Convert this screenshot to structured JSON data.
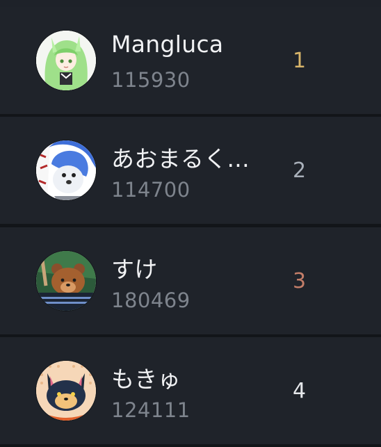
{
  "leaderboard": {
    "rows": [
      {
        "name": "Mangluca",
        "score": "115930",
        "rank": "1",
        "rank_color": "#d8b56a",
        "avatar": "green-haired-character-avatar"
      },
      {
        "name": "あおまるく...",
        "score": "114700",
        "rank": "2",
        "rank_color": "#a9b0ba",
        "avatar": "blue-wolf-character-avatar"
      },
      {
        "name": "すけ",
        "score": "180469",
        "rank": "3",
        "rank_color": "#c47e69",
        "avatar": "brown-bear-character-avatar"
      },
      {
        "name": "もきゅ",
        "score": "124111",
        "rank": "4",
        "rank_color": "#e6e8eb",
        "avatar": "black-cat-character-avatar"
      }
    ]
  }
}
